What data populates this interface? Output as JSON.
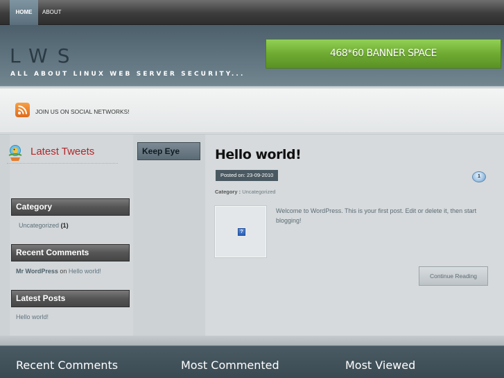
{
  "nav": {
    "items": [
      {
        "label": "HOME",
        "active": true
      },
      {
        "label": "ABOUT",
        "active": false
      }
    ]
  },
  "header": {
    "logo": "LWS",
    "tagline": "ALL ABOUT LINUX WEB SERVER SECURITY...",
    "banner": "468*60 BANNER SPACE"
  },
  "social": {
    "text": "JOIN US ON SOCIAL NETWORKS!",
    "icon": "rss-icon"
  },
  "sidebar": {
    "tweets_title": "Latest Tweets",
    "keep_eye": "Keep Eye",
    "category": {
      "title": "Category",
      "items": [
        {
          "label": "Uncategorized",
          "count": "(1)"
        }
      ]
    },
    "recent_comments": {
      "title": "Recent Comments",
      "items": [
        {
          "author": "Mr WordPress",
          "on": "on",
          "post": "Hello world!"
        }
      ]
    },
    "latest_posts": {
      "title": "Latest Posts",
      "items": [
        "Hello world!"
      ]
    }
  },
  "post": {
    "title": "Hello world!",
    "posted_on": "Posted on: 23-09-2010",
    "comment_count": "1",
    "category_label": "Category :",
    "category": "Uncategorized",
    "excerpt": "Welcome to WordPress. This is your first post. Edit or delete it, then start blogging!",
    "thumb_placeholder": "?",
    "continue": "Continue Reading"
  },
  "footer": {
    "headings": [
      "Recent Comments",
      "Most Commented",
      "Most Viewed"
    ]
  },
  "colors": {
    "accent_red": "#b3262a",
    "banner_green": "#6fab32",
    "header_slate": "#5d717d"
  }
}
